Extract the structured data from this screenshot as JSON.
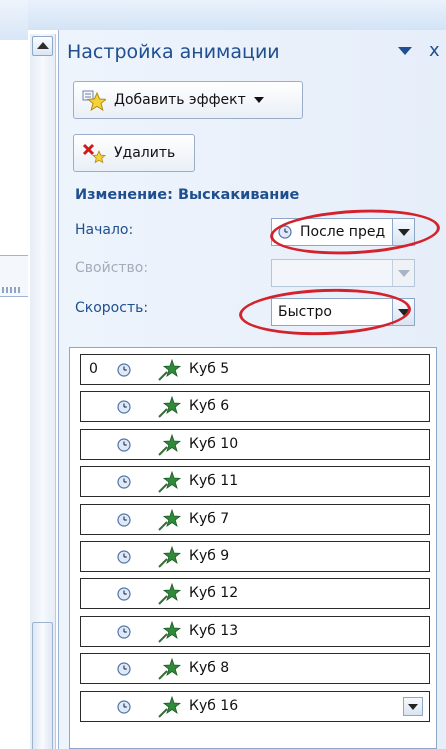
{
  "pane": {
    "title": "Настройка анимации",
    "add_effect_label": "Добавить эффект",
    "delete_label": "Удалить",
    "change_title": "Изменение: Выскакивание",
    "start_label": "Начало:",
    "start_value": "После пред",
    "property_label": "Свойство:",
    "property_value": "",
    "speed_label": "Скорость:",
    "speed_value": "Быстро",
    "close_glyph": "x"
  },
  "colors": {
    "accent": "#1f4f8f",
    "highlight_circle": "#d4222d",
    "pane_bg": "#eef4fc"
  },
  "icons": {
    "star": "star-effect-icon",
    "clock": "clock-icon",
    "effect": "green-star-effect-icon"
  },
  "animations": [
    {
      "order": "0",
      "name": "Куб 5"
    },
    {
      "order": "",
      "name": "Куб 6"
    },
    {
      "order": "",
      "name": "Куб 10"
    },
    {
      "order": "",
      "name": "Куб 11"
    },
    {
      "order": "",
      "name": "Куб 7"
    },
    {
      "order": "",
      "name": "Куб 9"
    },
    {
      "order": "",
      "name": "Куб 12"
    },
    {
      "order": "",
      "name": "Куб 13"
    },
    {
      "order": "",
      "name": "Куб 8"
    },
    {
      "order": "",
      "name": "Куб 16"
    }
  ]
}
